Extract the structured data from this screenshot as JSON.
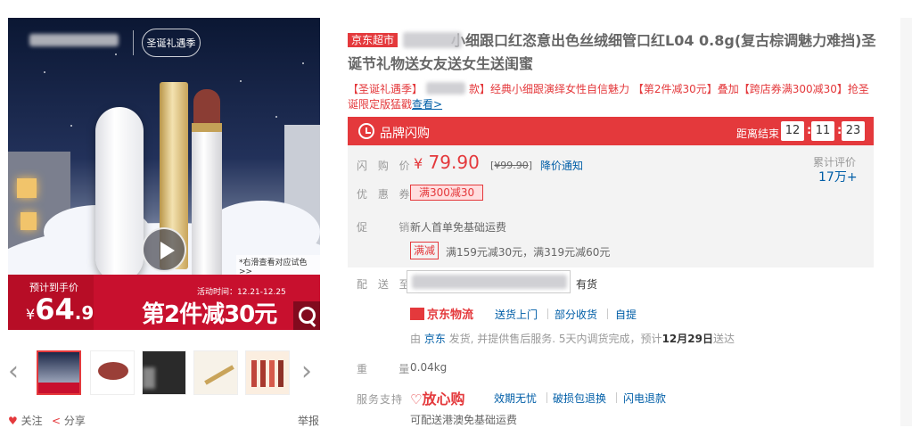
{
  "gallery": {
    "seal_text": "圣诞礼遇季",
    "zoom_hint": "*右滑查看对应试色 >>",
    "presale_label": "预计到手价",
    "price_currency": "¥",
    "price_int": "64",
    "price_dec": ".9",
    "activity_time": "活动时间：12.21-12.25",
    "promo_headline": "第2件减30元"
  },
  "actions": {
    "follow": "关注",
    "share": "分享",
    "report": "举报"
  },
  "product": {
    "store_tag": "京东超市",
    "title": "小细跟口红恣意出色丝绒细管口红L04 0.8g(复古棕调魅力难挡)圣诞节礼物送女友送女生送闺蜜",
    "subtitle": "【圣诞礼遇季】",
    "subtitle_rest": "款】经典小细跟演绎女性自信魅力 【第2件减30元】叠加【跨店券满300减30】抢圣诞限定版猛戳",
    "subtitle_link": "查看>"
  },
  "flash": {
    "title": "品牌闪购",
    "countdown_label": "距离结束",
    "hours": "12",
    "minutes": "11",
    "seconds": "23"
  },
  "price": {
    "label": "闪 购 价",
    "currency": "¥",
    "value": "79.90",
    "original_prefix": "[",
    "original": "¥99.90",
    "original_suffix": "]",
    "notice": "降价通知",
    "review_label": "累计评价",
    "review_count": "17万+"
  },
  "coupon": {
    "label": "优 惠 券",
    "text": "满300减30"
  },
  "promotion": {
    "label": "促    销",
    "line1": "新人首单免基础运费",
    "tag": "满减",
    "line2": "满159元减30元，满319元减60元"
  },
  "delivery": {
    "label": "配 送 至",
    "stock": "有货",
    "logistics": "京东物流",
    "services": [
      "送货上门",
      "部分收货",
      "自提"
    ],
    "ship_prefix": "由 ",
    "ship_by": "京东",
    "ship_mid": " 发货, 并提供售后服务. 5天内调货完成，预计",
    "ship_date": "12月29日",
    "ship_suffix": "送达"
  },
  "weight": {
    "label": "重    量",
    "value": "0.04kg"
  },
  "support": {
    "label": "服务支持",
    "fxg": "放心购",
    "items": [
      "效期无忧",
      "破损包退换",
      "闪电退款"
    ],
    "hk_line": "可配送港澳免基础运费"
  }
}
